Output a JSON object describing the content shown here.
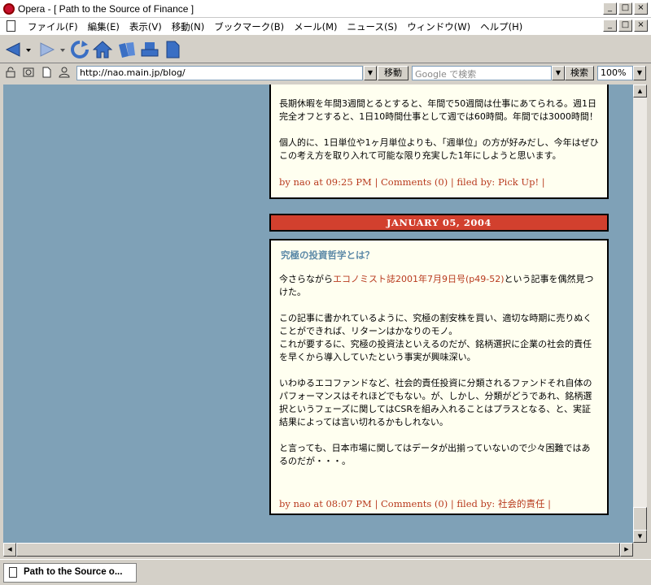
{
  "window": {
    "title": "Opera - [ Path to the Source of Finance ]",
    "minimize": "_",
    "maximize": "□",
    "close": "×"
  },
  "menu": {
    "items": [
      "ファイル(F)",
      "編集(E)",
      "表示(V)",
      "移動(N)",
      "ブックマーク(B)",
      "メール(M)",
      "ニュース(S)",
      "ウィンドウ(W)",
      "ヘルプ(H)"
    ]
  },
  "toolbar": {
    "icons": [
      "back-icon",
      "forward-icon",
      "reload-icon",
      "home-icon",
      "hotlist-icon",
      "print-icon",
      "page-icon"
    ]
  },
  "address": {
    "url": "http://nao.main.jp/blog/",
    "go_label": "移動",
    "search_placeholder": "Google で検索",
    "search_label": "検索",
    "zoom": "100%"
  },
  "colors": {
    "page_bg": "#7fa1b7",
    "post_bg": "#fffff0",
    "accent_red": "#d2402e",
    "link_red": "#b83a1e",
    "title_blue": "#5d8aa8"
  },
  "posts": [
    {
      "paragraphs": [
        "長期休暇を年間3週間とるとすると、年間で50週間は仕事にあてられる。週1日完全オフとすると、1日10時間仕事として週では60時間。年間では3000時間！",
        "個人的に、1日単位や1ヶ月単位よりも、「週単位」の方が好みだし、今年はぜひこの考え方を取り入れて可能な限り充実した1年にしようと思います。"
      ],
      "footer": "by nao at 09:25 PM | Comments (0) | filed by: Pick Up! |"
    },
    {
      "date": "JANUARY 05, 2004",
      "title": "究極の投資哲学とは？",
      "intro_before": "今さらながら",
      "intro_link": "エコノミスト誌2001年7月9日号(p49-52)",
      "intro_after": "という記事を偶然見つけた。",
      "paragraphs": [
        "この記事に書かれているように、究極の割安株を買い、適切な時期に売りぬくことができれば、リターンはかなりのモノ。\nこれが要するに、究極の投資法といえるのだが、銘柄選択に企業の社会的責任を早くから導入していたという事実が興味深い。",
        "いわゆるエコファンドなど、社会的責任投資に分類されるファンドそれ自体のパフォーマンスはそれほどでもない。が、しかし、分類がどうであれ、銘柄選択というフェーズに関してはCSRを組み入れることはプラスとなる、と、実証結果によっては言い切れるかもしれない。",
        "と言っても、日本市場に関してはデータが出揃っていないので少々困難ではあるのだが・・・。"
      ],
      "footer": "by nao at 08:07 PM | Comments (0) | filed by: 社会的責任 |"
    }
  ],
  "status": {
    "tab_title": "Path to the Source o..."
  }
}
